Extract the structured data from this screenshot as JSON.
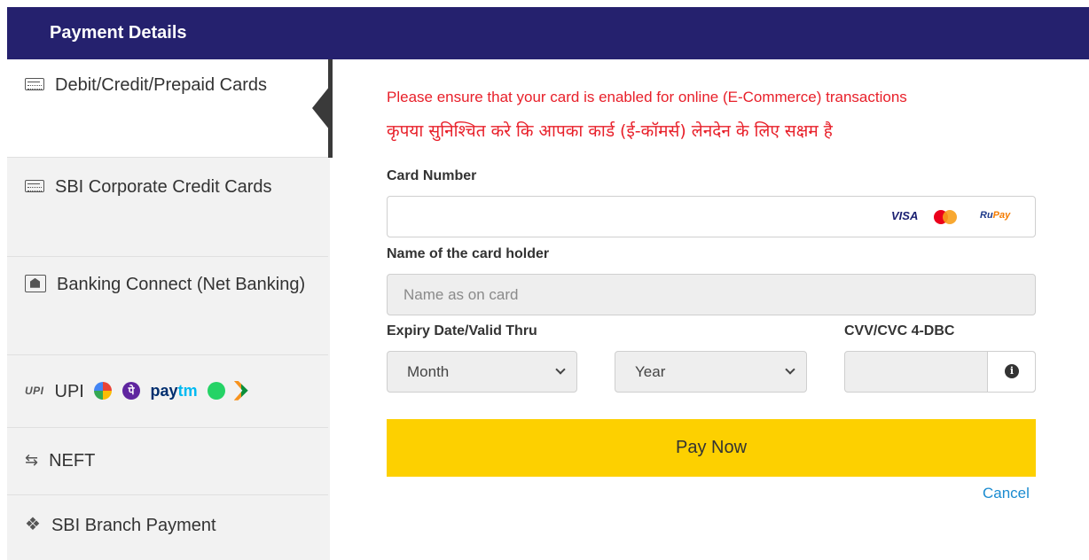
{
  "header": {
    "title": "Payment Details"
  },
  "sidebar": {
    "items": [
      {
        "label": "Debit/Credit/Prepaid Cards",
        "icon": "card-icon",
        "active": true
      },
      {
        "label": "SBI Corporate Credit Cards",
        "icon": "card-icon"
      },
      {
        "label": "Banking Connect (Net Banking)",
        "icon": "bank-icon"
      },
      {
        "label": "UPI",
        "icon": "upi-icon",
        "badge": "UPI",
        "apps": [
          "gpay",
          "phonepe",
          "paytm",
          "whatsapp",
          "bhim"
        ],
        "paytm_text": "pay",
        "paytm_text2": "tm",
        "phonepe_glyph": "पे"
      },
      {
        "label": "NEFT",
        "icon": "transfer-icon"
      },
      {
        "label": "SBI Branch Payment",
        "icon": "cash-icon"
      }
    ]
  },
  "form": {
    "notice_en": "Please ensure that your card is enabled for online (E-Commerce) transactions",
    "notice_hi": "कृपया सुनिश्चित करे कि आपका कार्ड (ई-कॉमर्स) लेनदेन के लिए सक्षम है",
    "card_number": {
      "label": "Card Number",
      "value": "",
      "brands": {
        "visa": "VISA",
        "rupay_a": "Ru",
        "rupay_b": "Pay"
      }
    },
    "card_holder": {
      "label": "Name of the card holder",
      "placeholder": "Name as on card",
      "value": ""
    },
    "expiry": {
      "label": "Expiry Date/Valid Thru",
      "month": "Month",
      "year": "Year"
    },
    "cvv": {
      "label": "CVV/CVC 4-DBC",
      "value": "",
      "info_glyph": "i"
    },
    "pay_button": "Pay Now",
    "cancel": "Cancel"
  },
  "colors": {
    "header_bg": "#25216e",
    "pay_button": "#fdd000",
    "notice": "#e8202a",
    "link": "#1a8bd0"
  }
}
